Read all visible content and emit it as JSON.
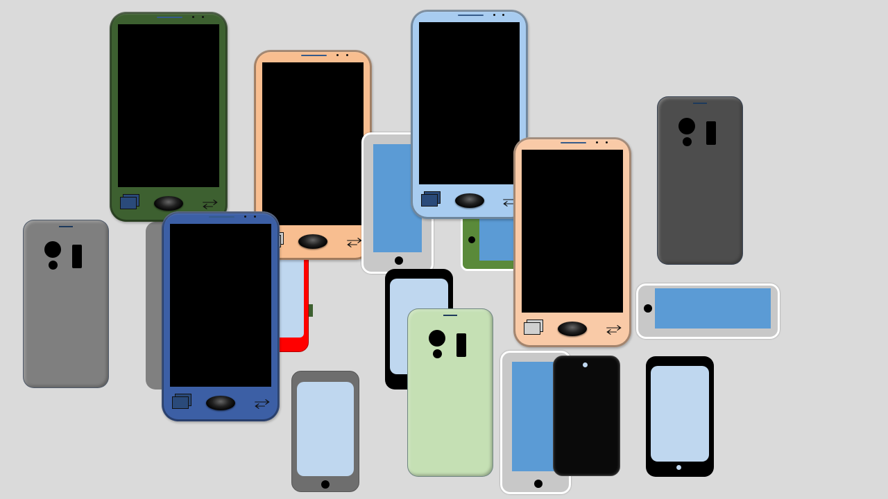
{
  "scene": {
    "background": "#dadada",
    "phones": [
      {
        "id": "rear-gray-left",
        "type": "rear-camera",
        "body": "#7f7f7f"
      },
      {
        "id": "partial-gray-edge",
        "type": "partial",
        "body": "#808080"
      },
      {
        "id": "red-phone",
        "type": "simple",
        "body": "#ff0000",
        "screen": "#bfd7ef"
      },
      {
        "id": "green-front",
        "type": "front-buttons",
        "body": "#3d6030",
        "back_glyph": "⥂"
      },
      {
        "id": "peach-front-top",
        "type": "front-buttons",
        "body": "#f8be90",
        "back_glyph": "⥂"
      },
      {
        "id": "blue-front-bottom",
        "type": "front-buttons",
        "body": "#3c5fa5",
        "back_glyph": "⥂"
      },
      {
        "id": "gray-white-rim-top",
        "type": "simple",
        "body": "#c8c8c8",
        "screen": "#5b9bd5"
      },
      {
        "id": "green-landscape-partial",
        "type": "simple",
        "body": "#5a8a3a",
        "screen": "#5b9bd5"
      },
      {
        "id": "lightblue-front",
        "type": "front-buttons",
        "body": "#a8ccf0",
        "back_glyph": "⥂"
      },
      {
        "id": "peach-front-right",
        "type": "front-buttons",
        "body": "#f9caa7",
        "back_glyph": "⥂"
      },
      {
        "id": "rear-darkgray-right",
        "type": "rear-camera",
        "body": "#4d4d4d"
      },
      {
        "id": "landscape-gray",
        "type": "simple",
        "body": "#c8c8c8",
        "screen": "#5b9bd5"
      },
      {
        "id": "black-phone-middle",
        "type": "simple",
        "body": "#000000",
        "screen": "#bfd7ef"
      },
      {
        "id": "gray-small-bottom",
        "type": "simple",
        "body": "#6e6e6e",
        "screen": "#bfd7ef"
      },
      {
        "id": "rear-mint",
        "type": "rear-camera",
        "body": "#c5e0b4"
      },
      {
        "id": "gray-white-rim-bottom",
        "type": "simple",
        "body": "#c8c8c8",
        "screen": "#5b9bd5"
      },
      {
        "id": "black-glossy",
        "type": "simple",
        "body": "#0a0a0a"
      },
      {
        "id": "black-phone-right",
        "type": "simple",
        "body": "#000000",
        "screen": "#bfd7ef"
      }
    ]
  }
}
